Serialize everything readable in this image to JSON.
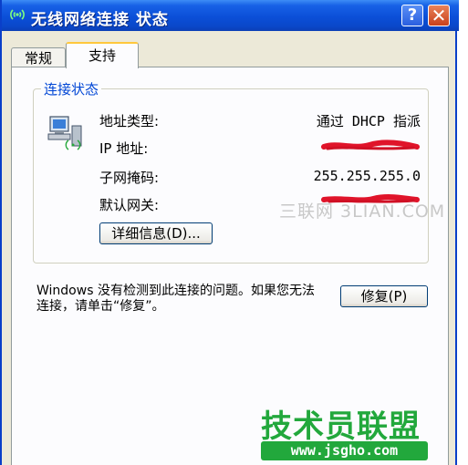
{
  "window": {
    "title": "无线网络连接 状态",
    "help_label": "?",
    "close_label": "✕"
  },
  "tabs": [
    {
      "label": "常规"
    },
    {
      "label": "支持"
    }
  ],
  "connection_status": {
    "legend": "连接状态",
    "rows": [
      {
        "label": "地址类型:",
        "value": "通过 DHCP 指派"
      },
      {
        "label": "IP 地址:",
        "value": ""
      },
      {
        "label": "子网掩码:",
        "value": "255.255.255.0"
      },
      {
        "label": "默认网关:",
        "value": ""
      }
    ],
    "details_button": "详细信息(D)..."
  },
  "repair": {
    "message": "Windows 没有检测到此连接的问题。如果您无法连接，请单击“修复”。",
    "button": "修复(P)"
  },
  "watermarks": {
    "top": "三联网 3LIAN.COM",
    "logo": "技术员联盟",
    "url": "www.jsgho.com"
  },
  "colors": {
    "titlebar": "#0b4fd8",
    "legend": "#0046d5",
    "redaction": "#e0142a",
    "logo_green": "#22a83c"
  },
  "icons": {
    "title": "wireless-network-icon",
    "status": "network-computer-icon"
  }
}
